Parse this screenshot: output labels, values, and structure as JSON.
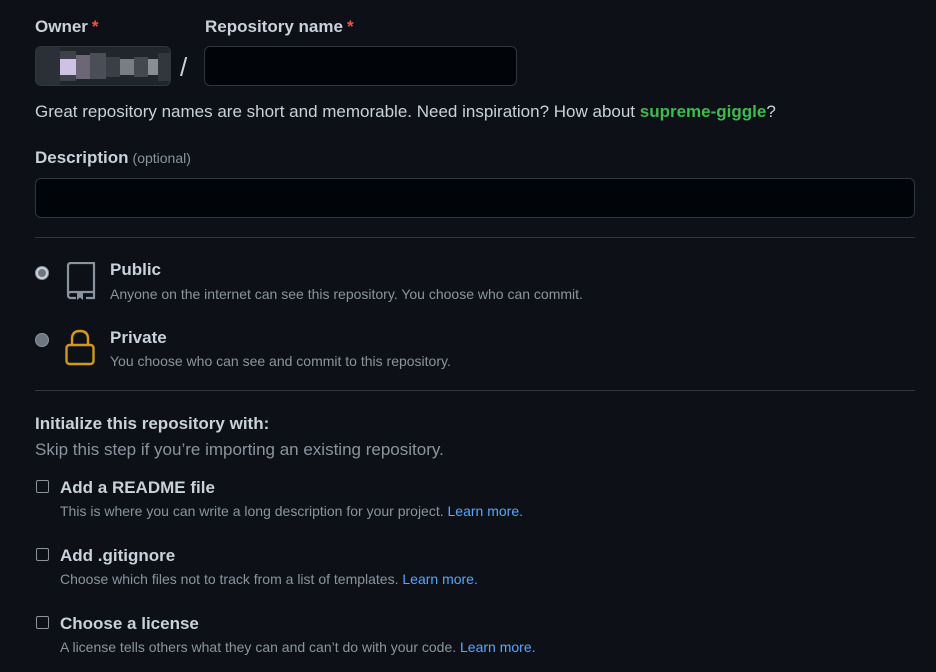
{
  "owner": {
    "label": "Owner",
    "required_mark": "*"
  },
  "repo_name": {
    "label": "Repository name",
    "required_mark": "*",
    "value": "",
    "placeholder": ""
  },
  "separator": "/",
  "hint": {
    "prefix": "Great repository names are short and memorable. Need inspiration? How about ",
    "suggestion": "supreme-giggle",
    "suffix": "?"
  },
  "description": {
    "label": "Description",
    "optional": "(optional)",
    "value": "",
    "placeholder": ""
  },
  "visibility": {
    "selected": "public",
    "options": [
      {
        "id": "public",
        "title": "Public",
        "desc": "Anyone on the internet can see this repository. You choose who can commit.",
        "icon": "repo-icon"
      },
      {
        "id": "private",
        "title": "Private",
        "desc": "You choose who can see and commit to this repository.",
        "icon": "lock-icon"
      }
    ]
  },
  "init": {
    "title": "Initialize this repository with:",
    "subtitle": "Skip this step if you’re importing an existing repository.",
    "learn_more": "Learn more.",
    "items": [
      {
        "title": "Add a README file",
        "desc": "This is where you can write a long description for your project.",
        "checked": false
      },
      {
        "title": "Add .gitignore",
        "desc": "Choose which files not to track from a list of templates.",
        "checked": false
      },
      {
        "title": "Choose a license",
        "desc": "A license tells others what they can and can’t do with your code.",
        "checked": false
      }
    ]
  },
  "colors": {
    "background": "#0d1117",
    "accent_green": "#3fb950",
    "link_blue": "#58a6ff",
    "required_red": "#f85149",
    "lock_yellow": "#d29922"
  }
}
